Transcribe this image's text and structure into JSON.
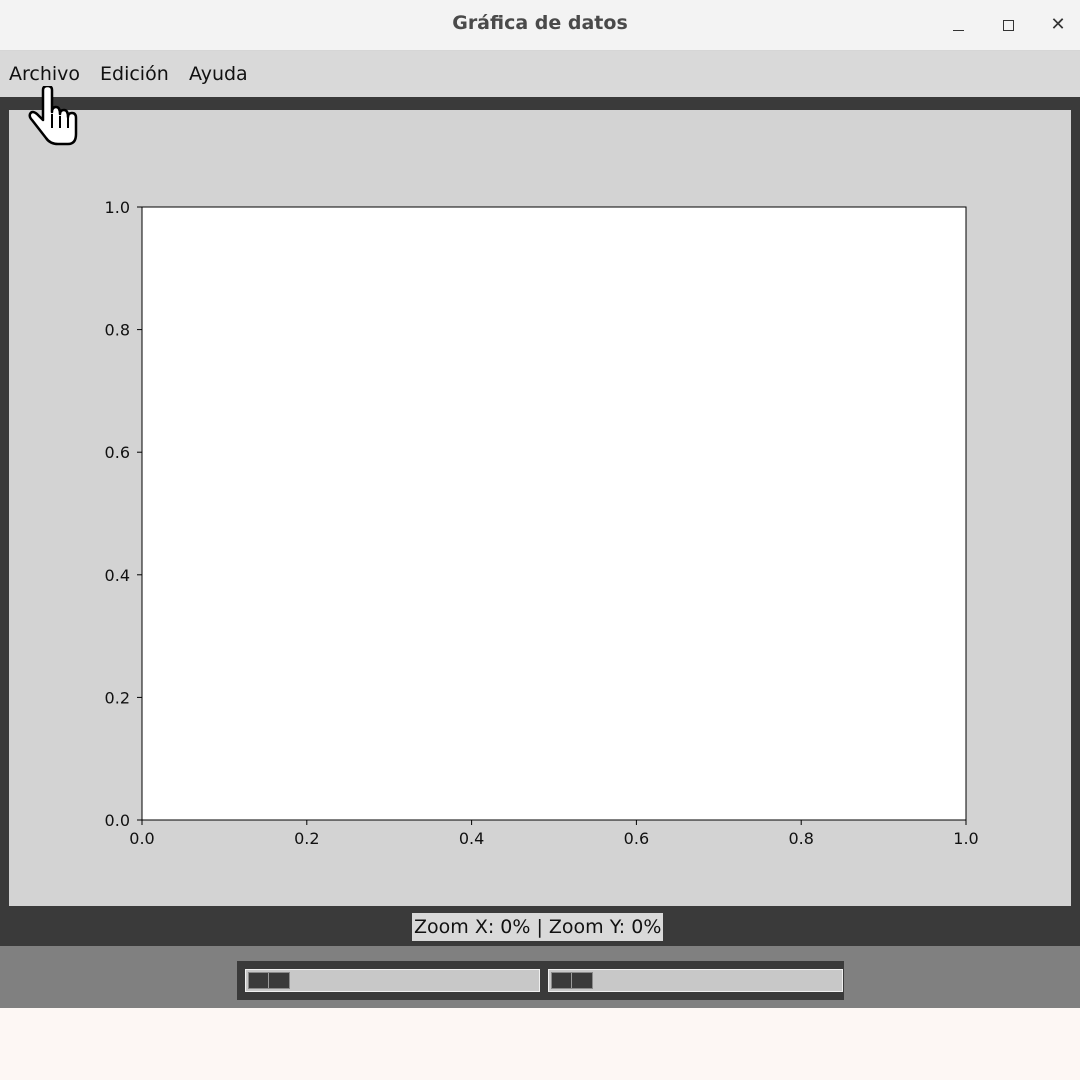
{
  "window": {
    "title": "Gráfica de datos"
  },
  "menu": {
    "items": [
      {
        "label": "Archivo"
      },
      {
        "label": "Edición"
      },
      {
        "label": "Ayuda"
      }
    ]
  },
  "status": {
    "text": "Zoom X: 0% | Zoom Y: 0%"
  },
  "sliders": {
    "zoom_x_fraction": 0,
    "zoom_y_fraction": 0
  },
  "chart_data": {
    "type": "line",
    "title": "",
    "xlabel": "",
    "ylabel": "",
    "xlim": [
      0.0,
      1.0
    ],
    "ylim": [
      0.0,
      1.0
    ],
    "xticks": [
      "0.0",
      "0.2",
      "0.4",
      "0.6",
      "0.8",
      "1.0"
    ],
    "yticks": [
      "0.0",
      "0.2",
      "0.4",
      "0.6",
      "0.8",
      "1.0"
    ],
    "grid": false,
    "series": []
  },
  "colors": {
    "frame": "#3a3a3a",
    "plot_background": "#d3d3d3",
    "axes_background": "#ffffff"
  }
}
